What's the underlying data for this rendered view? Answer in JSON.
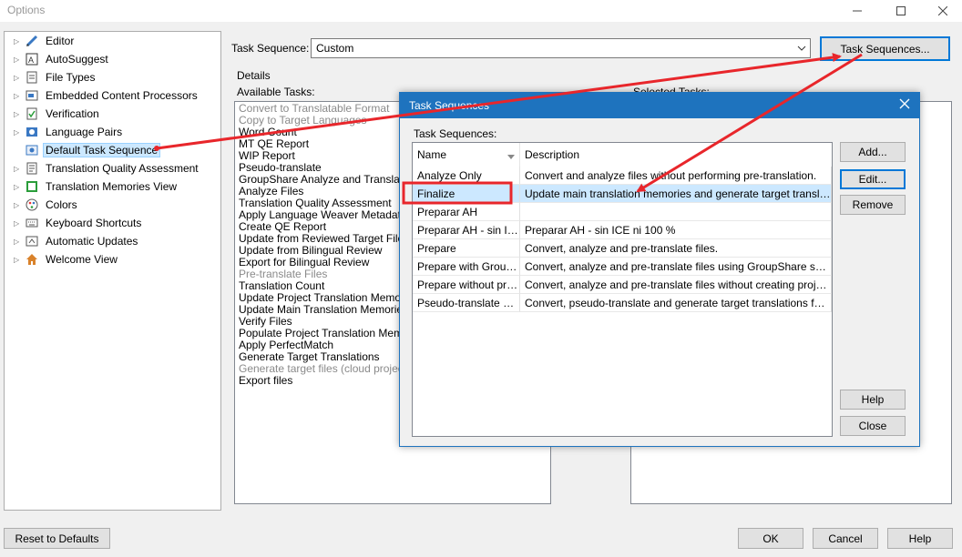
{
  "window": {
    "title": "Options"
  },
  "tree": {
    "items": [
      {
        "label": "Editor",
        "icon": "pencil-icon"
      },
      {
        "label": "AutoSuggest",
        "icon": "autosuggest-icon"
      },
      {
        "label": "File Types",
        "icon": "file-types-icon"
      },
      {
        "label": "Embedded Content Processors",
        "icon": "embedded-content-icon"
      },
      {
        "label": "Verification",
        "icon": "verification-icon"
      },
      {
        "label": "Language Pairs",
        "icon": "language-pairs-icon"
      },
      {
        "label": "Default Task Sequence",
        "icon": "task-sequence-icon"
      },
      {
        "label": "Translation Quality Assessment",
        "icon": "quality-icon"
      },
      {
        "label": "Translation Memories View",
        "icon": "tm-icon"
      },
      {
        "label": "Colors",
        "icon": "palette-icon"
      },
      {
        "label": "Keyboard Shortcuts",
        "icon": "keyboard-icon"
      },
      {
        "label": "Automatic Updates",
        "icon": "updates-icon"
      },
      {
        "label": "Welcome View",
        "icon": "home-icon"
      }
    ]
  },
  "task_sequence": {
    "label": "Task Sequence:",
    "value": "Custom",
    "button": "Task Sequences..."
  },
  "details": {
    "title": "Details",
    "available_label": "Available Tasks:",
    "selected_label": "Selected Tasks:",
    "available": [
      {
        "text": "Convert to Translatable Format",
        "disabled": true
      },
      {
        "text": "Copy to Target Languages",
        "disabled": true
      },
      {
        "text": "Word Count",
        "disabled": false
      },
      {
        "text": "MT QE Report",
        "disabled": false
      },
      {
        "text": "WIP Report",
        "disabled": false
      },
      {
        "text": "Pseudo-translate",
        "disabled": false
      },
      {
        "text": "GroupShare Analyze and Translate",
        "disabled": false
      },
      {
        "text": "Analyze Files",
        "disabled": false
      },
      {
        "text": "Translation Quality Assessment",
        "disabled": false
      },
      {
        "text": "Apply Language Weaver Metadata",
        "disabled": false
      },
      {
        "text": "Create QE Report",
        "disabled": false
      },
      {
        "text": "Update from Reviewed Target File",
        "disabled": false
      },
      {
        "text": "Update from Bilingual Review",
        "disabled": false
      },
      {
        "text": "Export for Bilingual Review",
        "disabled": false
      },
      {
        "text": "Pre-translate Files",
        "disabled": true
      },
      {
        "text": "Translation Count",
        "disabled": false
      },
      {
        "text": "Update Project Translation Memories",
        "disabled": false
      },
      {
        "text": "Update Main Translation Memories",
        "disabled": false
      },
      {
        "text": "Verify Files",
        "disabled": false
      },
      {
        "text": "Populate Project Translation Memories",
        "disabled": false
      },
      {
        "text": "Apply PerfectMatch",
        "disabled": false
      },
      {
        "text": "Generate Target Translations",
        "disabled": false
      },
      {
        "text": "Generate target files (cloud projects)",
        "disabled": true
      },
      {
        "text": "Export files",
        "disabled": false
      }
    ]
  },
  "buttons": {
    "reset": "Reset to Defaults",
    "ok": "OK",
    "cancel": "Cancel",
    "help": "Help"
  },
  "dialog": {
    "title": "Task Sequences",
    "list_label": "Task Sequences:",
    "columns": [
      "Name",
      "Description"
    ],
    "rows": [
      {
        "name": "Analyze Only",
        "desc": "Convert and analyze files without performing pre-translation."
      },
      {
        "name": "Finalize",
        "desc": "Update main translation memories and generate target translatio..."
      },
      {
        "name": "Preparar AH",
        "desc": ""
      },
      {
        "name": "Preparar AH - sin ICE",
        "desc": "Preparar AH - sin ICE ni 100 %"
      },
      {
        "name": "Prepare",
        "desc": "Convert, analyze and pre-translate files."
      },
      {
        "name": "Prepare with Group...",
        "desc": "Convert, analyze and pre-translate files using GroupShare server-..."
      },
      {
        "name": "Prepare without pro...",
        "desc": "Convert, analyze and pre-translate files without creating project t..."
      },
      {
        "name": "Pseudo-translate Ro...",
        "desc": "Convert, pseudo-translate and generate target translations for fil..."
      }
    ],
    "selected_index": 1,
    "buttons": {
      "add": "Add...",
      "edit": "Edit...",
      "remove": "Remove",
      "help": "Help",
      "close": "Close"
    }
  },
  "colors": {
    "accent": "#1e73be",
    "selection": "#cce8ff",
    "annotation": "#e8262b"
  }
}
